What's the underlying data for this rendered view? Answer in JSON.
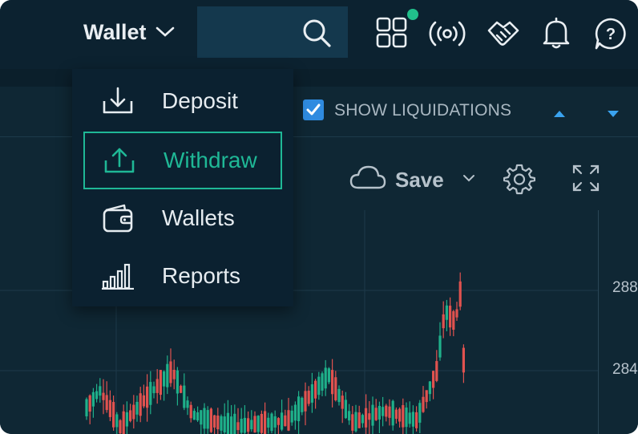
{
  "header": {
    "wallet_label": "Wallet",
    "icons": [
      "search-icon",
      "apps-grid-icon",
      "broadcast-icon",
      "handshake-icon",
      "bell-icon",
      "help-icon"
    ]
  },
  "wallet_dropdown": {
    "items": [
      {
        "label": "Deposit",
        "icon": "download-tray-icon",
        "active": false
      },
      {
        "label": "Withdraw",
        "icon": "upload-tray-icon",
        "active": true
      },
      {
        "label": "Wallets",
        "icon": "wallet-icon",
        "active": false
      },
      {
        "label": "Reports",
        "icon": "bar-chart-icon",
        "active": false
      }
    ]
  },
  "chart_options": {
    "show_liquidations_label": "SHOW LIQUIDATIONS",
    "show_liquidations_checked": true
  },
  "chart_toolbar": {
    "save_label": "Save"
  },
  "price_axis": {
    "labels": [
      "288",
      "284"
    ]
  },
  "colors": {
    "accent_green": "#1fb896",
    "up_candle": "#1fb08a",
    "down_candle": "#e0524f",
    "checkbox_blue": "#2f8be0"
  }
}
